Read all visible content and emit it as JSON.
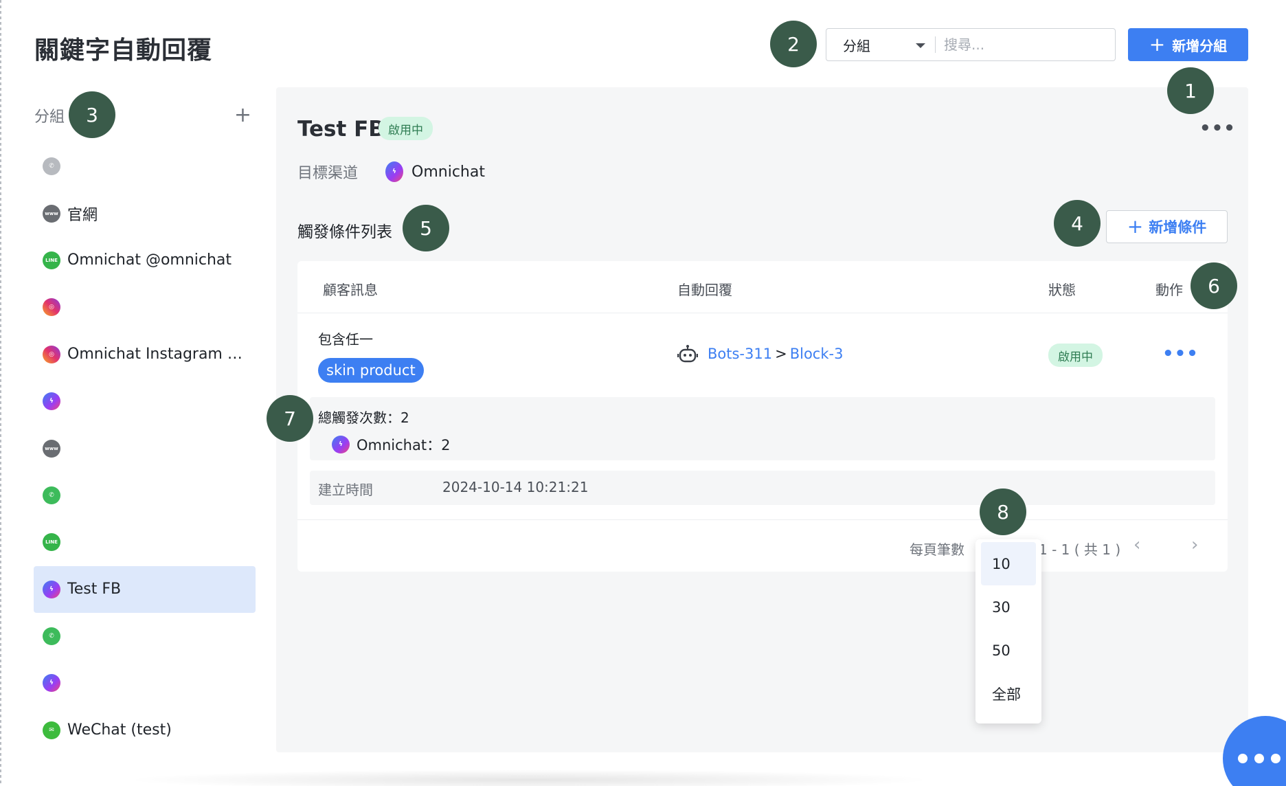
{
  "page": {
    "title": "關鍵字自動回覆"
  },
  "toolbar": {
    "group_select_value": "分組",
    "search_placeholder": "搜尋...",
    "add_group_label": "新增分組"
  },
  "sidebar": {
    "header": "分組",
    "items": [
      {
        "icon": "whatsapp-icon",
        "label": ""
      },
      {
        "icon": "www-icon",
        "label": "官網"
      },
      {
        "icon": "line-icon",
        "label": "Omnichat @omnichat"
      },
      {
        "icon": "instagram-icon",
        "label": ""
      },
      {
        "icon": "instagram-icon",
        "label": "Omnichat Instagram O…"
      },
      {
        "icon": "messenger-icon",
        "label": ""
      },
      {
        "icon": "www-icon",
        "label": ""
      },
      {
        "icon": "whatsapp-icon",
        "label": ""
      },
      {
        "icon": "line-icon",
        "label": ""
      },
      {
        "icon": "messenger-icon",
        "label": "Test FB",
        "selected": true
      },
      {
        "icon": "whatsapp-icon",
        "label": ""
      },
      {
        "icon": "messenger-icon",
        "label": ""
      },
      {
        "icon": "wechat-icon",
        "label": "WeChat (test)"
      }
    ]
  },
  "detail": {
    "title": "Test FB",
    "status_badge": "啟用中",
    "more": "•••",
    "target_label": "目標渠道",
    "target_channel": "Omnichat",
    "section_title": "觸發條件列表",
    "add_condition_label": "新增條件"
  },
  "table": {
    "headers": {
      "message": "顧客訊息",
      "reply": "自動回覆",
      "status": "狀態",
      "action": "動作"
    },
    "row": {
      "match_type": "包含任一",
      "keyword": "skin product",
      "bot": "Bots-311",
      "separator": ">",
      "block": "Block-3",
      "status": "啟用中",
      "more": "•••",
      "total_label": "總觸發次數：2",
      "channel_count_label": "Omnichat：2",
      "created_label": "建立時間",
      "created_value": "2024-10-14 10:21:21"
    }
  },
  "pagination": {
    "per_page_label": "每頁筆數",
    "range": "1 - 1 ( 共 1 )",
    "prev": "‹",
    "next": "›",
    "options": [
      "10",
      "30",
      "50",
      "全部"
    ],
    "selected": "10"
  },
  "markers": [
    "1",
    "2",
    "3",
    "4",
    "5",
    "6",
    "7",
    "8"
  ],
  "colors": {
    "primary": "#3d7ff2",
    "marker": "#3a5b4a",
    "active_badge_bg": "#d3f5e3",
    "selected_item_bg": "#dde8fb"
  }
}
